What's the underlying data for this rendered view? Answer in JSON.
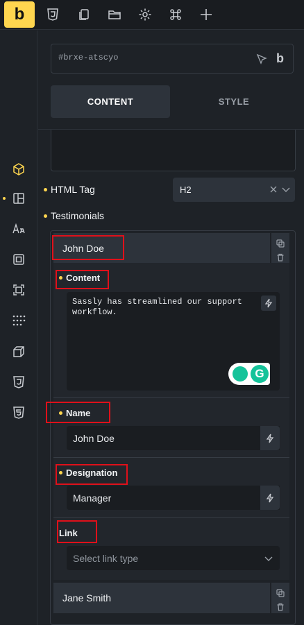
{
  "toolbar": {
    "logo": "b",
    "icons": [
      "css3-icon",
      "copy-icon",
      "folder-icon",
      "gear-icon",
      "command-icon",
      "plus-icon"
    ]
  },
  "rail": {
    "icons": [
      "cube-icon",
      "layout-icon",
      "typography-icon",
      "box-model-icon",
      "frame-icon",
      "grid-dots-icon",
      "3d-box-icon",
      "css3-icon",
      "html5-icon"
    ],
    "active": "cube-icon"
  },
  "panel": {
    "element_id": "#brxe-atscyo",
    "brand": "b",
    "tabs": {
      "content": "CONTENT",
      "style": "STYLE"
    },
    "html_tag": {
      "label": "HTML Tag",
      "value": "H2"
    },
    "testimonials": {
      "label": "Testimonials",
      "items": [
        {
          "title": "John Doe",
          "content_label": "Content",
          "content_value": "Sassly has streamlined our support workflow.",
          "name_label": "Name",
          "name_value": "John Doe",
          "designation_label": "Designation",
          "designation_value": "Manager",
          "link_label": "Link",
          "link_placeholder": "Select link type"
        },
        {
          "title": "Jane Smith"
        }
      ]
    }
  },
  "colors": {
    "accent": "#ffd64f",
    "highlight": "#e0101a",
    "panel_bg": "#1e2227"
  }
}
